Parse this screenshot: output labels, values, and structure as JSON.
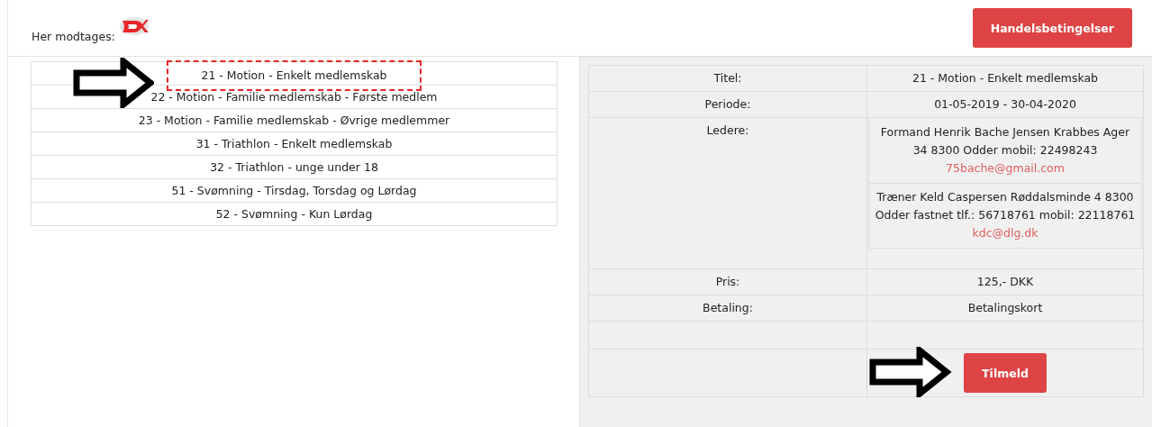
{
  "header": {
    "label": "Her modtages:",
    "button": "Handelsbetingelser"
  },
  "memberships": [
    {
      "label": "21 - Motion - Enkelt medlemskab",
      "selected": true
    },
    {
      "label": "22 - Motion - Familie medlemskab - Første medlem",
      "selected": false
    },
    {
      "label": "23 - Motion - Familie medlemskab - Øvrige medlemmer",
      "selected": false
    },
    {
      "label": "31 - Triathlon - Enkelt medlemskab",
      "selected": false
    },
    {
      "label": "32 - Triathlon - unge under 18",
      "selected": false
    },
    {
      "label": "51 - Svømning - Tirsdag, Torsdag og Lørdag",
      "selected": false
    },
    {
      "label": "52 - Svømning - Kun Lørdag",
      "selected": false
    }
  ],
  "details": {
    "rows": [
      {
        "kind": "text",
        "label": "Titel:",
        "value": "21 - Motion - Enkelt medlemskab"
      },
      {
        "kind": "text",
        "label": "Periode:",
        "value": "01-05-2019 - 30-04-2020"
      },
      {
        "kind": "leaders",
        "label": "Ledere:",
        "leaders": [
          {
            "text": "Formand Henrik Bache Jensen Krabbes Ager 34 8300 Odder mobil: 22498243",
            "email": "75bache@gmail.com"
          },
          {
            "text": "Træner Keld Caspersen Røddalsminde 4 8300 Odder fastnet tlf.: 56718761 mobil: 22118761",
            "email": "kdc@dlg.dk"
          }
        ]
      },
      {
        "kind": "text",
        "label": "Pris:",
        "value": "125,- DKK"
      },
      {
        "kind": "text",
        "label": "Betaling:",
        "value": "Betalingskort"
      },
      {
        "kind": "empty"
      },
      {
        "kind": "button",
        "button": "Tilmeld",
        "pointed": true
      }
    ]
  }
}
